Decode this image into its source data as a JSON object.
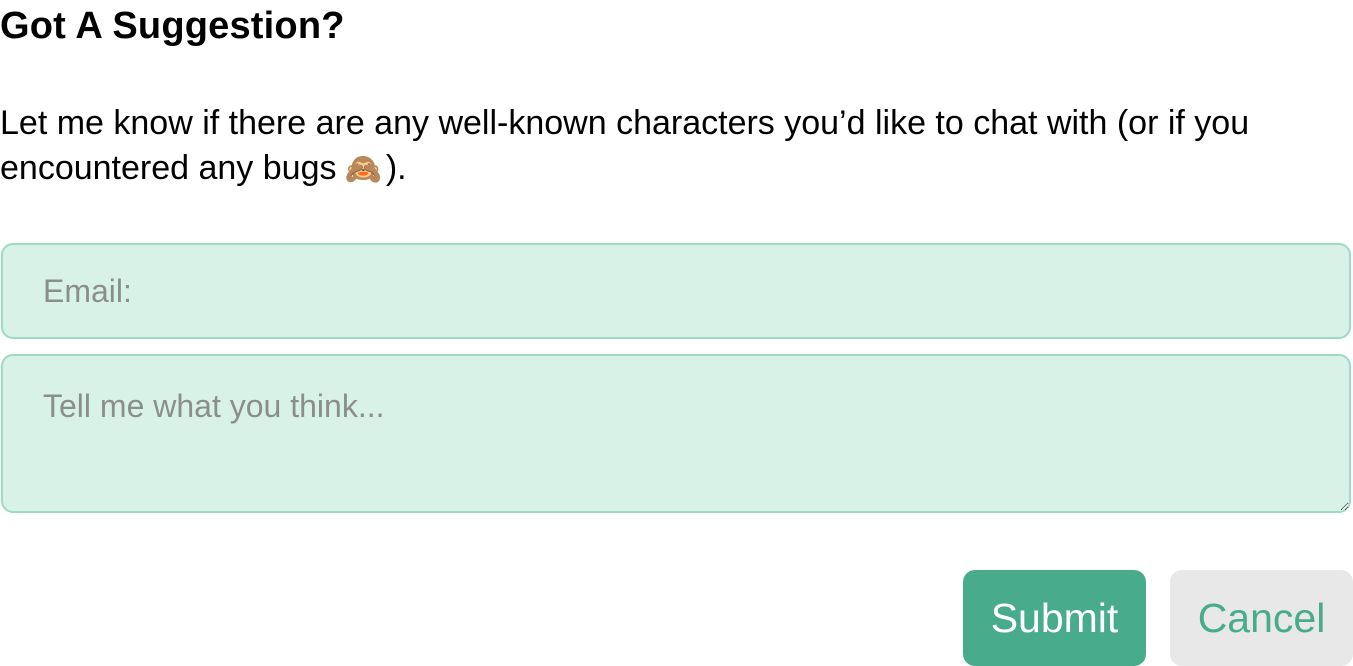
{
  "dialog": {
    "title": "Got A Suggestion?",
    "description_text": "Let me know if there are any well-known characters you’d like to chat with (or if you encountered any bugs",
    "description_emoji": "🙈",
    "description_end": ")."
  },
  "form": {
    "email_placeholder": "Email:",
    "email_value": "",
    "message_placeholder": "Tell me what you think...",
    "message_value": ""
  },
  "actions": {
    "submit_label": "Submit",
    "cancel_label": "Cancel"
  },
  "colors": {
    "accent": "#48ab8b",
    "field_background": "#d9f2e8",
    "field_border": "#9ddac3",
    "cancel_background": "#e8e8e8"
  },
  "icons": {
    "description_emoji": "see-no-evil-monkey-icon",
    "textarea_resize": "resize-handle-icon"
  }
}
